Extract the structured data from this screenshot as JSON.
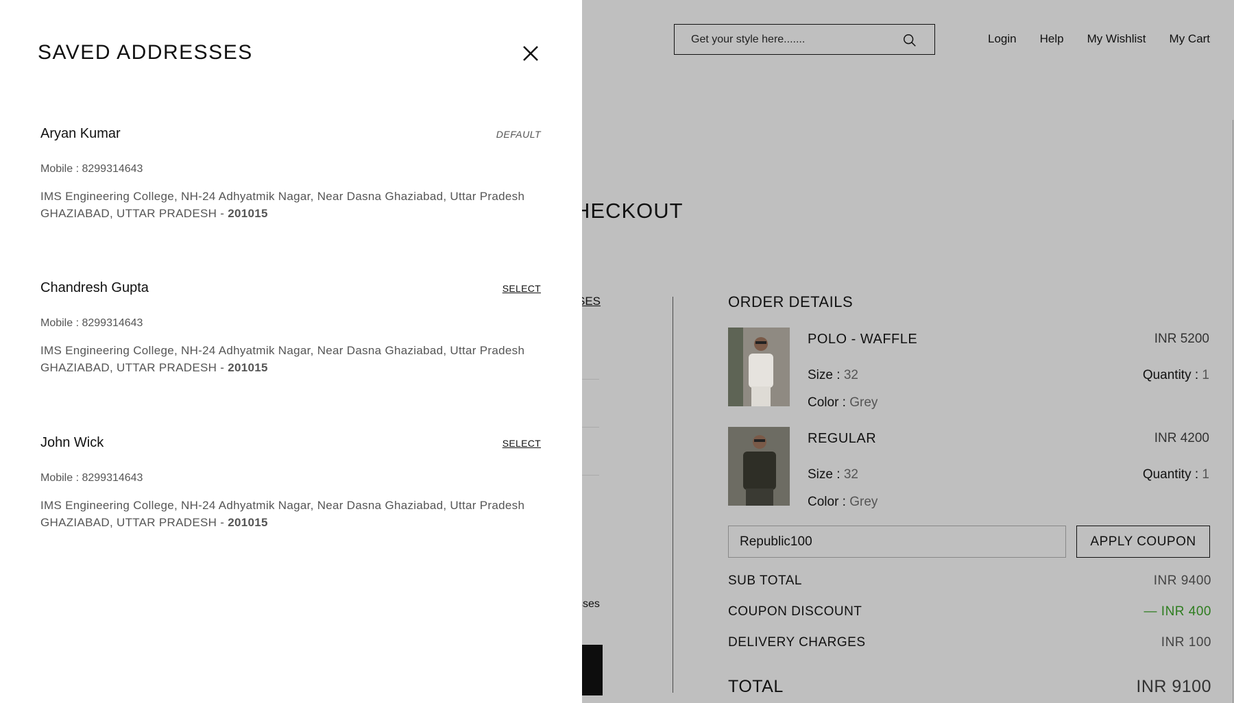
{
  "header": {
    "search_placeholder": "Get your style here.......",
    "nav": [
      "Login",
      "Help",
      "My Wishlist",
      "My Cart"
    ]
  },
  "checkout": {
    "title_partial": "HECKOUT",
    "addresses_link_partial": "SES",
    "addresses_text_partial": "sses"
  },
  "order": {
    "title": "ORDER DETAILS",
    "products": [
      {
        "name": "POLO - WAFFLE",
        "price": "INR 5200",
        "size_label": "Size :",
        "size": "32",
        "color_label": "Color :",
        "color": "Grey",
        "qty_label": "Quantity :",
        "qty": "1",
        "thumb_color": "#c9c4bd"
      },
      {
        "name": "REGULAR",
        "price": "INR 4200",
        "size_label": "Size :",
        "size": "32",
        "color_label": "Color :",
        "color": "Grey",
        "qty_label": "Quantity :",
        "qty": "1",
        "thumb_color": "#3d3c33"
      }
    ],
    "coupon_value": "Republic100",
    "apply_label": "APPLY COUPON",
    "summary": [
      {
        "label": "SUB TOTAL",
        "value": "INR 9400"
      },
      {
        "label": "COUPON DISCOUNT",
        "value": "— INR 400"
      },
      {
        "label": "DELIVERY CHARGES",
        "value": "INR 100"
      }
    ],
    "total_label": "TOTAL",
    "total_value": "INR 9100",
    "discount_color": "#2e7d1f"
  },
  "panel": {
    "title": "SAVED ADDRESSES",
    "addresses": [
      {
        "name": "Aryan Kumar",
        "tag": "DEFAULT",
        "mobile": "Mobile : 8299314643",
        "line1": "IMS Engineering College, NH-24 Adhyatmik Nagar, Near Dasna Ghaziabad, Uttar Pradesh",
        "line2": "GHAZIABAD, UTTAR PRADESH - ",
        "pin": "201015"
      },
      {
        "name": "Chandresh Gupta",
        "tag": "SELECT",
        "mobile": "Mobile : 8299314643",
        "line1": "IMS Engineering College, NH-24 Adhyatmik Nagar, Near Dasna Ghaziabad, Uttar Pradesh",
        "line2": "GHAZIABAD, UTTAR PRADESH - ",
        "pin": "201015"
      },
      {
        "name": "John Wick",
        "tag": "SELECT",
        "mobile": "Mobile : 8299314643",
        "line1": "IMS Engineering College, NH-24 Adhyatmik Nagar, Near Dasna Ghaziabad, Uttar Pradesh",
        "line2": "GHAZIABAD, UTTAR PRADESH - ",
        "pin": "201015"
      }
    ]
  }
}
